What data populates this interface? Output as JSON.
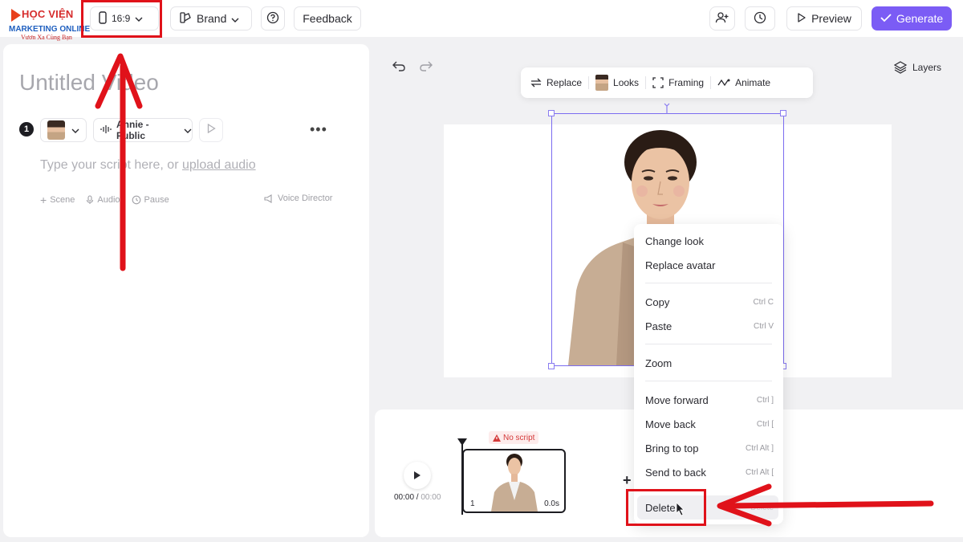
{
  "logo": {
    "line1": "HỌC VIỆN",
    "line2": "MARKETING ONLINE",
    "line3": "Vươn Xa Cùng Bạn"
  },
  "topbar": {
    "ratio_label": "16:9",
    "brand_label": "Brand",
    "feedback_label": "Feedback",
    "preview_label": "Preview",
    "generate_label": "Generate"
  },
  "editor": {
    "title": "Untitled Video",
    "scene_number": "1",
    "voice_label": "Annie - Public",
    "script_placeholder": "Type your script here, or",
    "upload_audio_link": "upload audio",
    "tools": {
      "scene": "Scene",
      "audio": "Audio",
      "pause": "Pause",
      "voice_director": "Voice Director"
    }
  },
  "canvas": {
    "layers_label": "Layers",
    "floating_bar": {
      "replace": "Replace",
      "looks": "Looks",
      "framing": "Framing",
      "animate": "Animate"
    }
  },
  "context_menu": {
    "change_look": "Change look",
    "replace_avatar": "Replace avatar",
    "copy": "Copy",
    "copy_shortcut": "Ctrl C",
    "paste": "Paste",
    "paste_shortcut": "Ctrl V",
    "zoom": "Zoom",
    "move_forward": "Move forward",
    "move_forward_shortcut": "Ctrl ]",
    "move_back": "Move back",
    "move_back_shortcut": "Ctrl [",
    "bring_to_top": "Bring to top",
    "bring_to_top_shortcut": "Ctrl Alt ]",
    "send_to_back": "Send to back",
    "send_to_back_shortcut": "Ctrl Alt [",
    "delete": "Delete",
    "delete_shortcut": "Delete"
  },
  "timeline": {
    "current_time": "00:00",
    "separator": " / ",
    "total_time": "00:00",
    "no_script_badge": "No script",
    "clip_number": "1",
    "clip_duration": "0.0s"
  },
  "colors": {
    "accent": "#7b5cf5",
    "annotation_red": "#e0121a",
    "selection": "#7b6cf0"
  }
}
